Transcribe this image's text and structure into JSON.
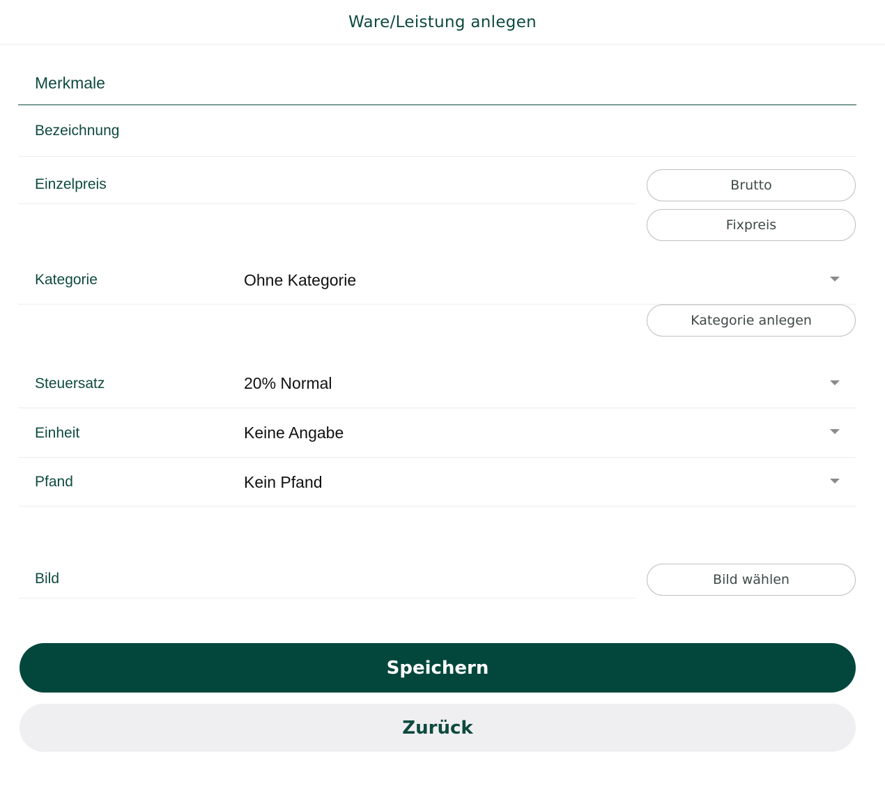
{
  "header": {
    "title": "Ware/Leistung anlegen"
  },
  "section": {
    "title": "Merkmale"
  },
  "fields": {
    "bezeichnung": {
      "label": "Bezeichnung"
    },
    "einzelpreis": {
      "label": "Einzelpreis"
    },
    "kategorie": {
      "label": "Kategorie",
      "value": "Ohne Kategorie"
    },
    "steuersatz": {
      "label": "Steuersatz",
      "value": "20% Normal"
    },
    "einheit": {
      "label": "Einheit",
      "value": "Keine Angabe"
    },
    "pfand": {
      "label": "Pfand",
      "value": "Kein Pfand"
    },
    "bild": {
      "label": "Bild"
    }
  },
  "buttons": {
    "brutto": "Brutto",
    "fixpreis": "Fixpreis",
    "kategorie_anlegen": "Kategorie anlegen",
    "bild_waehlen": "Bild wählen",
    "speichern": "Speichern",
    "zurueck": "Zurück"
  },
  "colors": {
    "accent": "#03473c",
    "label_text": "#0e4a3e",
    "secondary_bg": "#efeff1"
  }
}
